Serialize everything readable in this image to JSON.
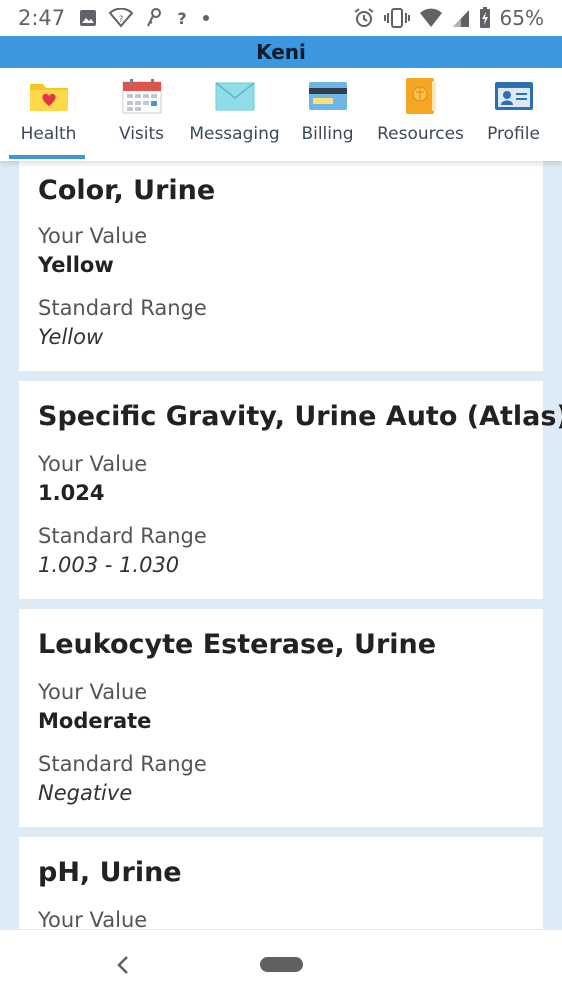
{
  "status": {
    "time": "2:47",
    "battery_percent": "65%",
    "left_icons": [
      "image-icon",
      "wifi-question-icon",
      "key-icon",
      "help-question-icon",
      "dot-icon"
    ],
    "right_icons": [
      "alarm-icon",
      "vibrate-icon",
      "wifi-icon",
      "signal-icon",
      "battery-icon"
    ]
  },
  "app": {
    "title": "Keni",
    "accent": "#3a97e0"
  },
  "nav": {
    "items": [
      {
        "label": "Health",
        "icon": "folder-heart-icon",
        "active": true
      },
      {
        "label": "Visits",
        "icon": "calendar-icon"
      },
      {
        "label": "Messaging",
        "icon": "envelope-icon"
      },
      {
        "label": "Billing",
        "icon": "credit-card-icon"
      },
      {
        "label": "Resources",
        "icon": "book-icon"
      },
      {
        "label": "Profile",
        "icon": "id-card-icon"
      }
    ]
  },
  "results": [
    {
      "title": "Color, Urine",
      "value_label": "Your Value",
      "value": "Yellow",
      "range_label": "Standard Range",
      "range": "Yellow"
    },
    {
      "title": "Specific Gravity, Urine Auto (Atlas)",
      "value_label": "Your Value",
      "value": "1.024",
      "range_label": "Standard Range",
      "range": "1.003 - 1.030"
    },
    {
      "title": "Leukocyte Esterase, Urine",
      "value_label": "Your Value",
      "value": "Moderate",
      "range_label": "Standard Range",
      "range": "Negative"
    },
    {
      "title": "pH, Urine",
      "value_label": "Your Value"
    }
  ],
  "system_nav": {
    "back_icon": "chevron-left-icon",
    "home_icon": "home-pill-icon"
  }
}
